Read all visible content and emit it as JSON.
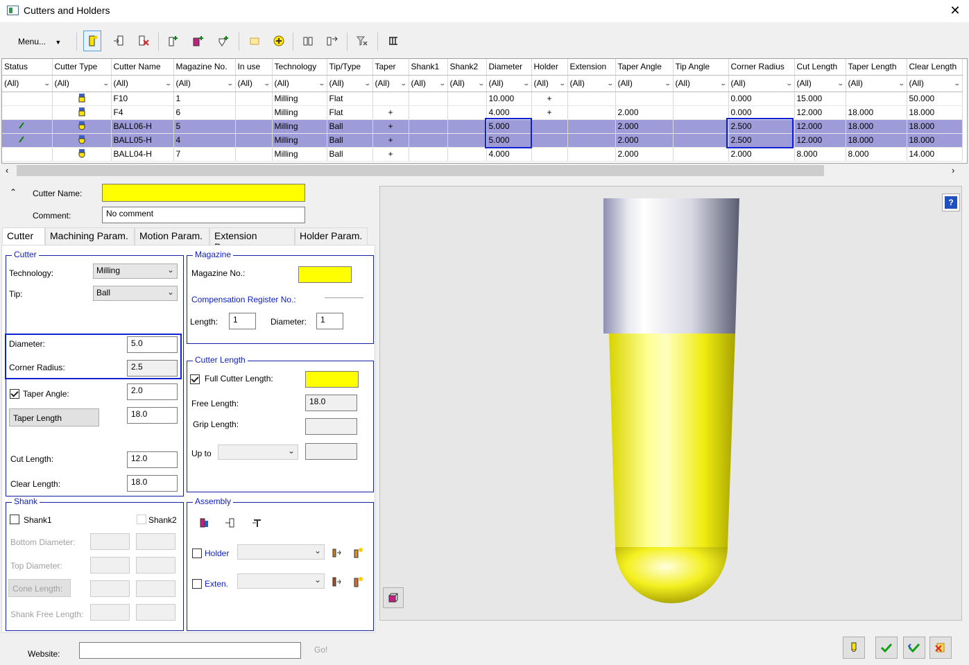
{
  "window": {
    "title": "Cutters and Holders",
    "close": "✕"
  },
  "toolbar": {
    "menu_label": "Menu..."
  },
  "grid": {
    "columns": [
      "Status",
      "Cutter Type",
      "Cutter Name",
      "Magazine No.",
      "In use",
      "Technology",
      "Tip/Type",
      "Taper",
      "Shank1",
      "Shank2",
      "Diameter",
      "Holder",
      "Extension",
      "Taper Angle",
      "Tip Angle",
      "Corner Radius",
      "Cut Length",
      "Taper Length",
      "Clear Length"
    ],
    "filter": "(All)",
    "rows": [
      {
        "name": "F10",
        "mag": "1",
        "tech": "Milling",
        "tip": "Flat",
        "taper": "",
        "diameter": "10.000",
        "holder": "+",
        "taper_angle": "",
        "corner": "0.000",
        "cut": "15.000",
        "taper_len": "",
        "clear": "50.000",
        "selected": false
      },
      {
        "name": "F4",
        "mag": "6",
        "tech": "Milling",
        "tip": "Flat",
        "taper": "+",
        "diameter": "4.000",
        "holder": "+",
        "taper_angle": "2.000",
        "corner": "0.000",
        "cut": "12.000",
        "taper_len": "18.000",
        "clear": "18.000",
        "selected": false
      },
      {
        "name": "BALL06-H",
        "mag": "5",
        "tech": "Milling",
        "tip": "Ball",
        "taper": "+",
        "diameter": "5.000",
        "holder": "",
        "taper_angle": "2.000",
        "corner": "2.500",
        "cut": "12.000",
        "taper_len": "18.000",
        "clear": "18.000",
        "selected": true
      },
      {
        "name": "BALL05-H",
        "mag": "4",
        "tech": "Milling",
        "tip": "Ball",
        "taper": "+",
        "diameter": "5.000",
        "holder": "",
        "taper_angle": "2.000",
        "corner": "2.500",
        "cut": "12.000",
        "taper_len": "18.000",
        "clear": "18.000",
        "selected": true
      },
      {
        "name": "BALL04-H",
        "mag": "7",
        "tech": "Milling",
        "tip": "Ball",
        "taper": "+",
        "diameter": "4.000",
        "holder": "",
        "taper_angle": "2.000",
        "corner": "2.000",
        "cut": "8.000",
        "taper_len": "8.000",
        "clear": "14.000",
        "selected": false
      }
    ]
  },
  "form": {
    "cutter_name_label": "Cutter Name:",
    "cutter_name_value": "",
    "comment_label": "Comment:",
    "comment_value": "No comment",
    "tabs": [
      "Cutter",
      "Machining Param.",
      "Motion Param.",
      "Extension Param.",
      "Holder Param."
    ],
    "cutter_group": {
      "title": "Cutter",
      "technology_label": "Technology:",
      "technology_value": "Milling",
      "tip_label": "Tip:",
      "tip_value": "Ball",
      "diameter_label": "Diameter:",
      "diameter_value": "5.0",
      "corner_label": "Corner Radius:",
      "corner_value": "2.5",
      "taper_angle_label": "Taper Angle:",
      "taper_angle_value": "2.0",
      "taper_length_label": "Taper Length",
      "taper_length_value": "18.0",
      "cut_length_label": "Cut Length:",
      "cut_length_value": "12.0",
      "clear_length_label": "Clear Length:",
      "clear_length_value": "18.0"
    },
    "magazine_group": {
      "title": "Magazine",
      "magazine_no_label": "Magazine No.:",
      "magazine_no_value": "",
      "comp_label": "Compensation Register No.:",
      "length_label": "Length:",
      "length_value": "1",
      "diameter_label": "Diameter:",
      "diameter_value": "1"
    },
    "cutter_length_group": {
      "title": "Cutter Length",
      "full_label": "Full Cutter Length:",
      "full_value": "",
      "free_label": "Free Length:",
      "free_value": "18.0",
      "grip_label": "Grip Length:",
      "grip_value": "",
      "upto_label": "Up to",
      "upto_value": ""
    },
    "shank_group": {
      "title": "Shank",
      "shank1": "Shank1",
      "shank2": "Shank2",
      "bottom_d": "Bottom Diameter:",
      "top_d": "Top Diameter:",
      "cone_len": "Cone Length:",
      "free_len": "Shank Free Length:"
    },
    "assembly_group": {
      "title": "Assembly",
      "holder_label": "Holder",
      "exten_label": "Exten."
    },
    "website_label": "Website:",
    "website_value": "",
    "go_label": "Go!"
  },
  "preview": {
    "help_icon": "?"
  },
  "colors": {
    "selection": "#9d9bd8",
    "highlight": "#1020d8",
    "yellow": "#ffff00"
  }
}
